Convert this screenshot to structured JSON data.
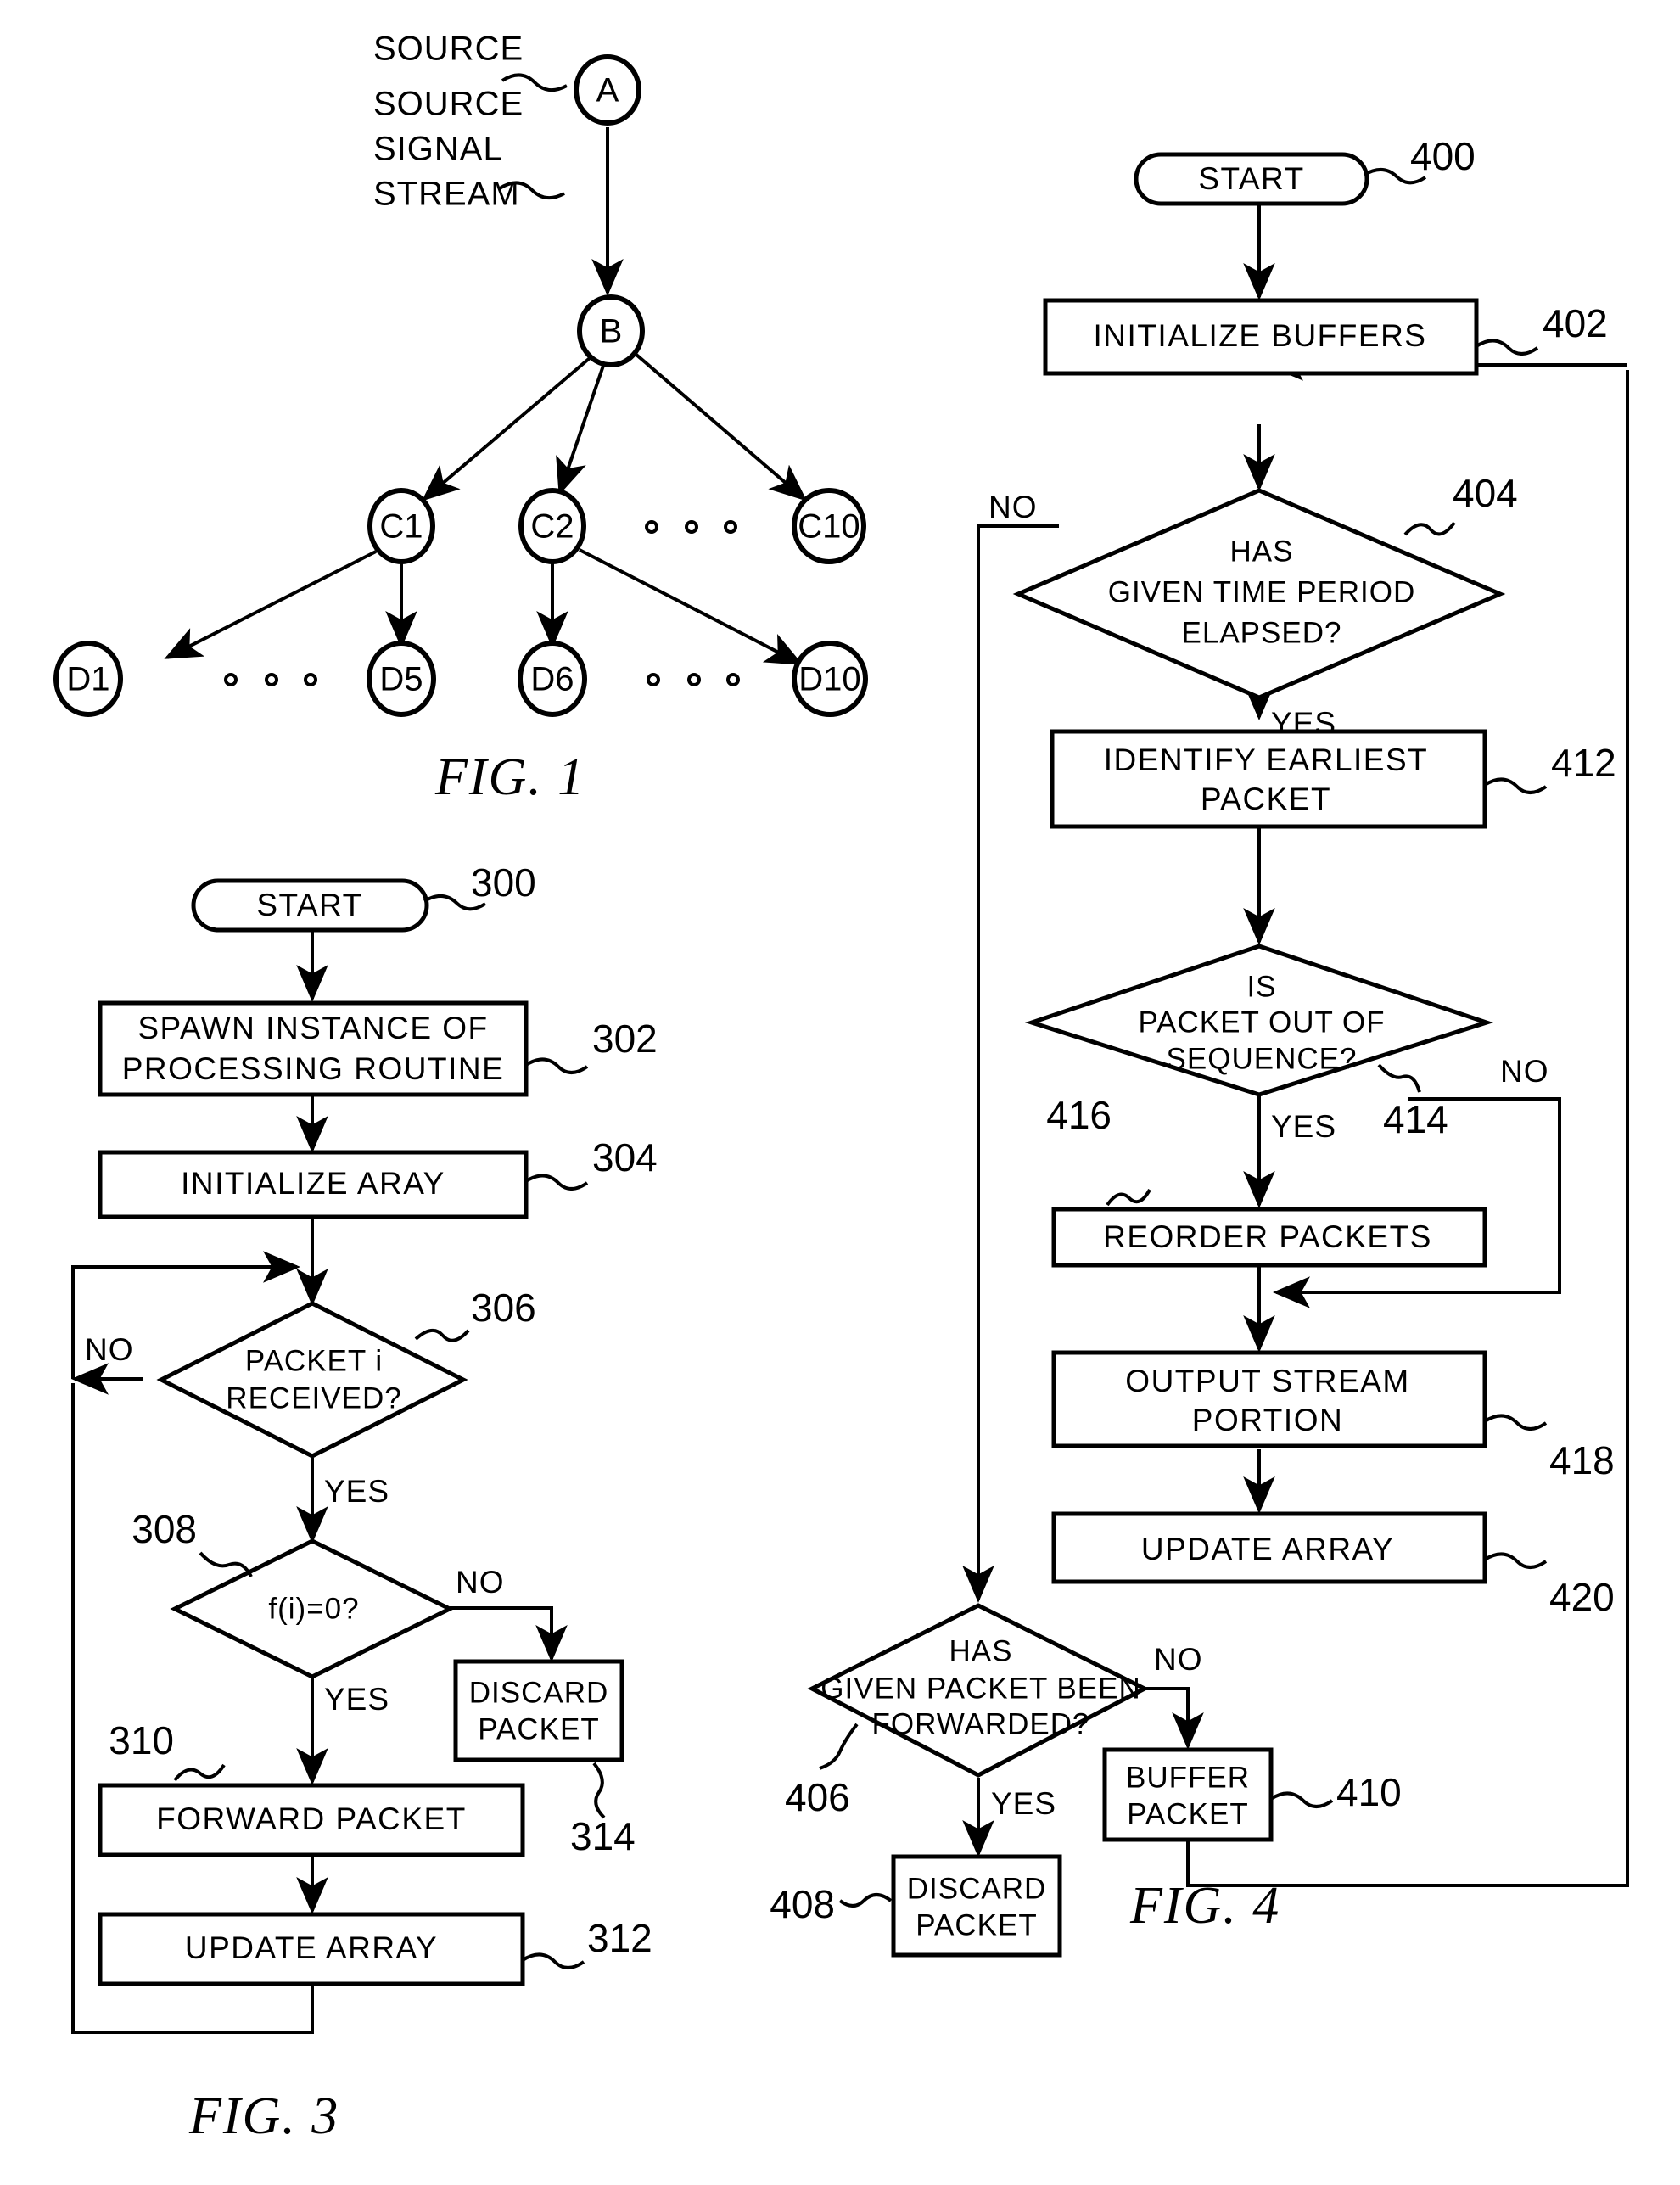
{
  "document": {
    "type": "patent-drawing-sheet",
    "figures": [
      "FIG.  1",
      "FIG.  3",
      "FIG.  4"
    ]
  },
  "fig1": {
    "caption": "FIG.  1",
    "annotations": {
      "source": "SOURCE",
      "source_signal_stream": [
        "SOURCE",
        "SIGNAL",
        "STREAM"
      ],
      "source_signal_stream_joined": "SOURCE SIGNAL STREAM"
    },
    "nodes": [
      {
        "id": "A",
        "label": "A",
        "level": 0
      },
      {
        "id": "B",
        "label": "B",
        "level": 1
      },
      {
        "id": "C1",
        "label": "C1",
        "level": 2
      },
      {
        "id": "C2",
        "label": "C2",
        "level": 2
      },
      {
        "id": "C10",
        "label": "C10",
        "level": 2
      },
      {
        "id": "D1",
        "label": "D1",
        "level": 3
      },
      {
        "id": "D5",
        "label": "D5",
        "level": 3
      },
      {
        "id": "D6",
        "label": "D6",
        "level": 3
      },
      {
        "id": "D10",
        "label": "D10",
        "level": 3
      }
    ],
    "edges": [
      {
        "from": "A",
        "to": "B"
      },
      {
        "from": "B",
        "to": "C1"
      },
      {
        "from": "B",
        "to": "C2"
      },
      {
        "from": "B",
        "to": "C10"
      },
      {
        "from": "C1",
        "to": "D1"
      },
      {
        "from": "C1",
        "to": "D5"
      },
      {
        "from": "C2",
        "to": "D6"
      },
      {
        "from": "C2",
        "to": "D10"
      }
    ],
    "ellipses": [
      {
        "between": [
          "C2",
          "C10"
        ],
        "count": 3
      },
      {
        "between": [
          "D1",
          "D5"
        ],
        "count": 3
      },
      {
        "between": [
          "D6",
          "D10"
        ],
        "count": 3
      }
    ]
  },
  "fig3": {
    "caption": "FIG.  3",
    "steps": [
      {
        "ref": "300",
        "shape": "terminator",
        "label": "START"
      },
      {
        "ref": "302",
        "shape": "process",
        "label": "SPAWN INSTANCE OF PROCESSING ROUTINE",
        "lines": [
          "SPAWN  INSTANCE  OF",
          "PROCESSING  ROUTINE"
        ]
      },
      {
        "ref": "304",
        "shape": "process",
        "label": "INITIALIZE ARAY",
        "lines": [
          "INITIALIZE  ARAY"
        ]
      },
      {
        "ref": "306",
        "shape": "decision",
        "label": "PACKET i RECEIVED?",
        "lines": [
          "PACKET  i",
          "RECEIVED?"
        ],
        "yes": "YES",
        "no": "NO"
      },
      {
        "ref": "308",
        "shape": "decision",
        "label": "f(i)=0?",
        "lines": [
          "f(i)=0?"
        ],
        "yes": "YES",
        "no": "NO"
      },
      {
        "ref": "310",
        "shape": "process",
        "label": "FORWARD PACKET",
        "lines": [
          "FORWARD  PACKET"
        ]
      },
      {
        "ref": "312",
        "shape": "process",
        "label": "UPDATE ARRAY",
        "lines": [
          "UPDATE  ARRAY"
        ]
      },
      {
        "ref": "314",
        "shape": "process",
        "label": "DISCARD PACKET",
        "lines": [
          "DISCARD",
          "PACKET"
        ]
      }
    ],
    "branch_labels": {
      "yes": "YES",
      "no": "NO"
    }
  },
  "fig4": {
    "caption": "FIG.  4",
    "steps": [
      {
        "ref": "400",
        "shape": "terminator",
        "label": "START"
      },
      {
        "ref": "402",
        "shape": "process",
        "label": "INITIALIZE BUFFERS",
        "lines": [
          "INITIALIZE  BUFFERS"
        ]
      },
      {
        "ref": "404",
        "shape": "decision",
        "label": "HAS GIVEN TIME PERIOD ELAPSED?",
        "lines": [
          "HAS",
          "GIVEN  TIME  PERIOD",
          "ELAPSED?"
        ],
        "yes": "YES",
        "no": "NO"
      },
      {
        "ref": "406",
        "shape": "decision",
        "label": "HAS GIVEN PACKET BEEN FORWARDED?",
        "lines": [
          "HAS",
          "GIVEN  PACKET  BEEN",
          "FORWARDED?"
        ],
        "yes": "YES",
        "no": "NO"
      },
      {
        "ref": "408",
        "shape": "process",
        "label": "DISCARD PACKET",
        "lines": [
          "DISCARD",
          "PACKET"
        ]
      },
      {
        "ref": "410",
        "shape": "process",
        "label": "BUFFER PACKET",
        "lines": [
          "BUFFER",
          "PACKET"
        ]
      },
      {
        "ref": "412",
        "shape": "process",
        "label": "IDENTIFY EARLIEST PACKET",
        "lines": [
          "IDENTIFY  EARLIEST",
          "PACKET"
        ]
      },
      {
        "ref": "414",
        "shape": "decision",
        "label": "IS PACKET OUT OF SEQUENCE?",
        "lines": [
          "IS",
          "PACKET  OUT  OF",
          "SEQUENCE?"
        ],
        "yes": "YES",
        "no": "NO"
      },
      {
        "ref": "416",
        "shape": "process",
        "label": "REORDER PACKETS",
        "lines": [
          "REORDER  PACKETS"
        ]
      },
      {
        "ref": "418",
        "shape": "process",
        "label": "OUTPUT STREAM PORTION",
        "lines": [
          "OUTPUT  STREAM",
          "PORTION"
        ]
      },
      {
        "ref": "420",
        "shape": "process",
        "label": "UPDATE ARRAY",
        "lines": [
          "UPDATE  ARRAY"
        ]
      }
    ],
    "branch_labels": {
      "yes": "YES",
      "no": "NO"
    }
  },
  "colors": {
    "ink": "#000000",
    "paper": "#ffffff"
  }
}
